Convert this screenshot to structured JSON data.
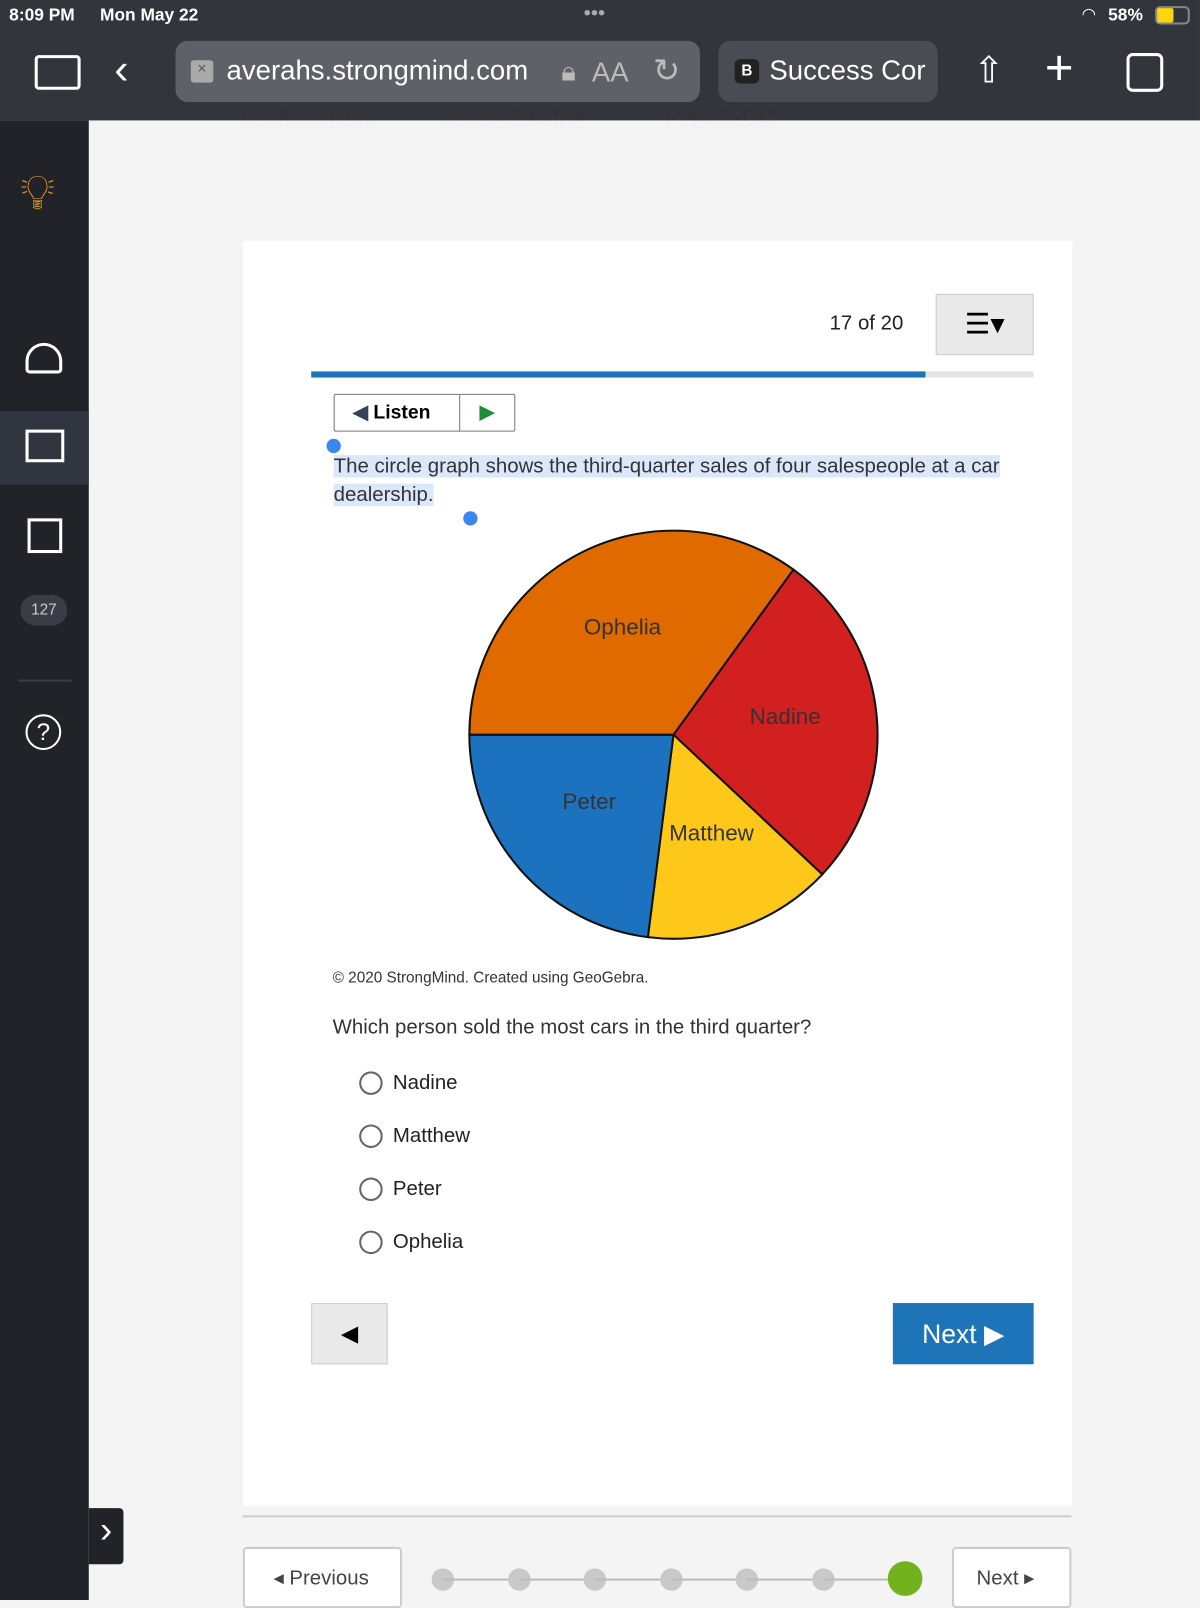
{
  "status_bar": {
    "time": "8:09 PM",
    "date": "Mon May 22",
    "battery": "58%"
  },
  "browser": {
    "url": "averahs.strongmind.com",
    "aa": "AA",
    "tab2_badge": "B",
    "tab2_title": "Success Cor"
  },
  "bookmarks": [
    "Conferences",
    "StrongMinded",
    "PlanetMath"
  ],
  "sidebar": {
    "mail_count": "127",
    "items": [
      "lightbulb",
      "dashboard",
      "courses",
      "calendar",
      "inbox",
      "help"
    ]
  },
  "question": {
    "counter": "17 of 20",
    "progress_percent": 85,
    "listen_label": "Listen",
    "prompt": "The circle graph shows the third-quarter sales of four salespeople at a car dealership.",
    "credit": "© 2020 StrongMind. Created using GeoGebra.",
    "question": "Which person sold the most cars in the third quarter?",
    "options": [
      "Nadine",
      "Matthew",
      "Peter",
      "Ophelia"
    ],
    "next_label": "Next"
  },
  "chart_data": {
    "type": "pie",
    "categories": [
      "Nadine",
      "Matthew",
      "Peter",
      "Ophelia"
    ],
    "values_percent": [
      27,
      15,
      23,
      35
    ],
    "colors": [
      "#d21f1f",
      "#fdc81a",
      "#1d72c0",
      "#e06900"
    ]
  },
  "footer": {
    "previous_label": "Previous",
    "next_label": "Next",
    "pages_shown": 7,
    "current_page_index": 6
  }
}
